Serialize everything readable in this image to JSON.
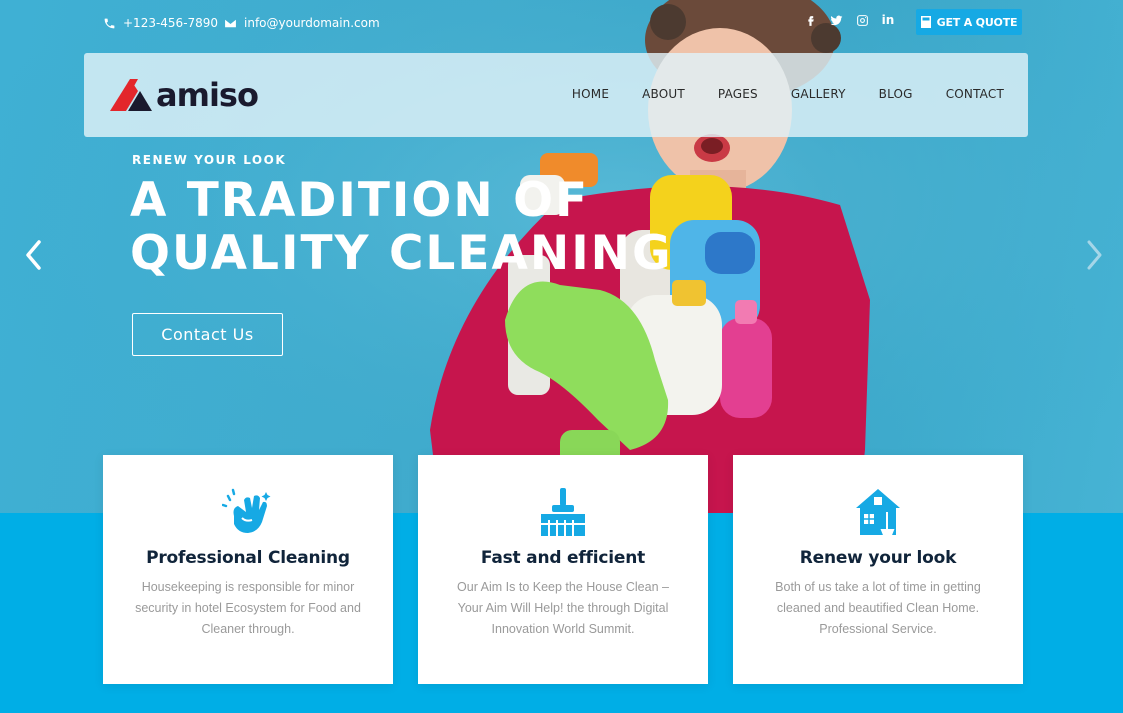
{
  "topbar": {
    "phone": "+123-456-7890",
    "email": "info@yourdomain.com",
    "social": [
      "facebook-icon",
      "twitter-icon",
      "instagram-icon",
      "linkedin-icon"
    ],
    "linkedin_glyph": "in",
    "quote_label": "GET A QUOTE"
  },
  "brand": {
    "name": "amiso",
    "colors": {
      "accent": "#00aee6",
      "logo_red": "#e3262b",
      "dark": "#10243a"
    }
  },
  "nav": {
    "items": [
      "HOME",
      "ABOUT",
      "PAGES",
      "GALLERY",
      "BLOG",
      "CONTACT"
    ]
  },
  "hero": {
    "tag": "RENEW YOUR LOOK",
    "title_line1": "A TRADITION OF",
    "title_line2": "QUALITY CLEANING",
    "button_label": "Contact Us"
  },
  "features": [
    {
      "icon": "cleaning-hand-icon",
      "title": "Professional Cleaning",
      "text": "Housekeeping is responsible for minor security in hotel Ecosystem for Food and Cleaner through."
    },
    {
      "icon": "broom-icon",
      "title": "Fast and efficient",
      "text": "Our Aim Is to Keep the House Clean – Your Aim Will Help! the through Digital Innovation World Summit."
    },
    {
      "icon": "house-icon",
      "title": "Renew your look",
      "text": "Both of us take a lot of time in getting cleaned and beautified Clean Home. Professional Service."
    }
  ]
}
